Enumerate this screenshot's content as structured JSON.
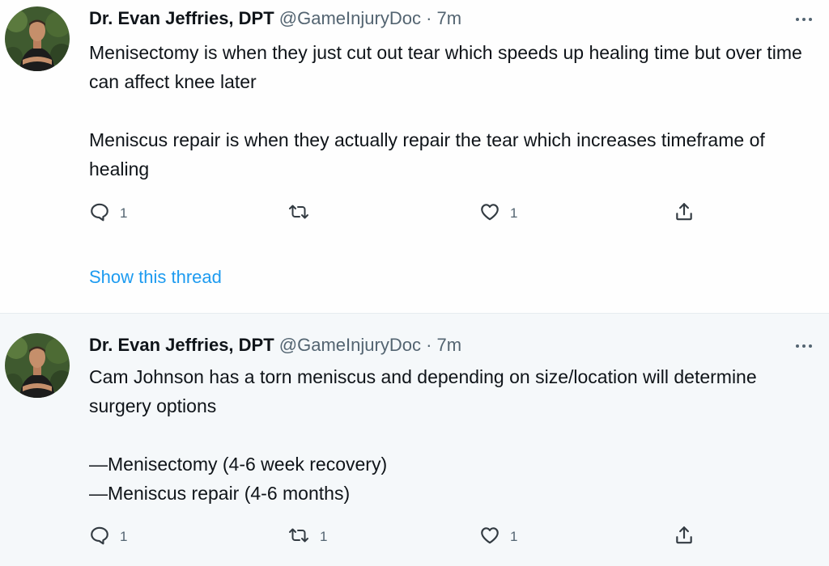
{
  "tweets": [
    {
      "author_name": "Dr. Evan Jeffries, DPT",
      "handle": "@GameInjuryDoc",
      "separator": "·",
      "time": "7m",
      "paragraphs": [
        "Menisectomy is when they just cut out tear which speeds up healing time but over time can affect knee later",
        "Meniscus repair is when they actually repair the tear which increases timeframe of healing"
      ],
      "reply_count": "1",
      "retweet_count": "",
      "like_count": "1",
      "show_thread": "Show this thread"
    },
    {
      "author_name": "Dr. Evan Jeffries, DPT",
      "handle": "@GameInjuryDoc",
      "separator": "·",
      "time": "7m",
      "paragraphs": [
        "Cam Johnson has a torn meniscus and depending on size/location will determine surgery options",
        "—Menisectomy (4-6 week recovery)",
        "—Meniscus repair (4-6 months)"
      ],
      "reply_count": "1",
      "retweet_count": "1",
      "like_count": "1"
    }
  ],
  "icons": {
    "reply": "reply-icon",
    "retweet": "retweet-icon",
    "like": "heart-icon",
    "share": "share-icon",
    "more": "more-options-icon"
  },
  "colors": {
    "link": "#1d9bf0",
    "secondary_text": "#536471",
    "primary_text": "#0f1419",
    "second_tweet_bg": "#f5f8fa"
  }
}
